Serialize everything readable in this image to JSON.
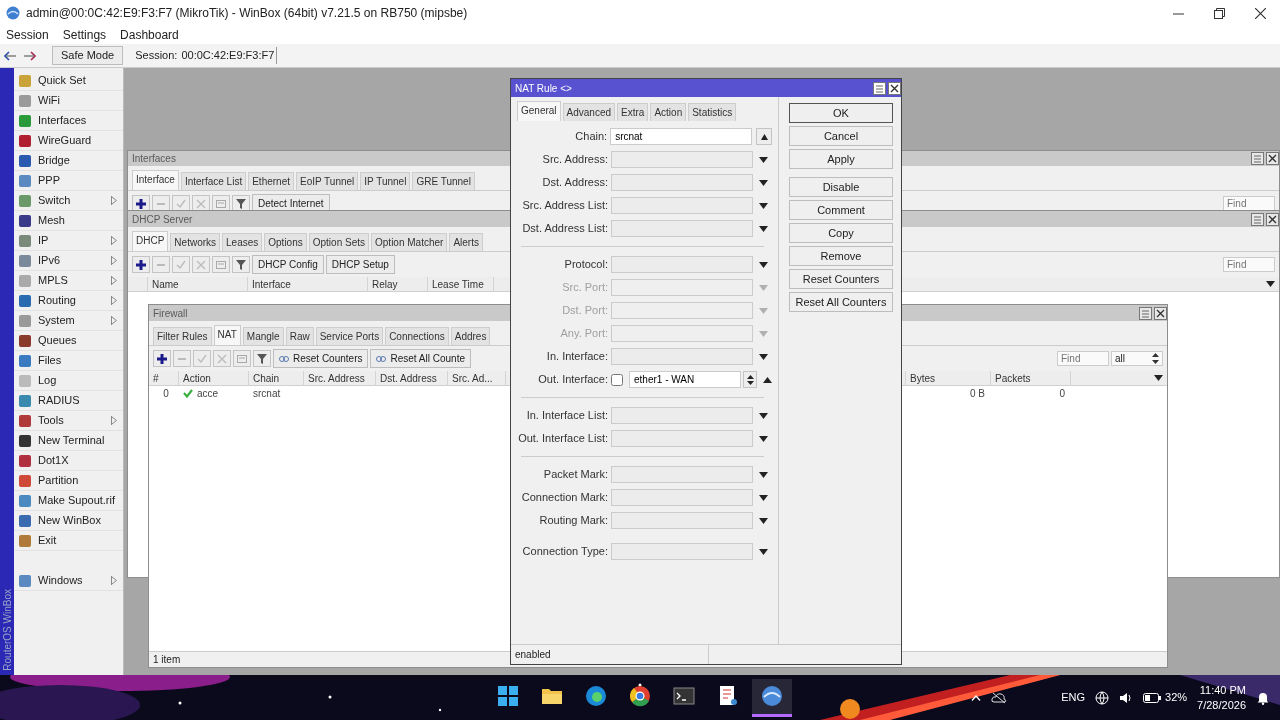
{
  "window": {
    "title": "admin@00:0C:42:E9:F3:F7 (MikroTik) - WinBox (64bit) v7.21.5 on RB750 (mipsbe)"
  },
  "menu_bar": [
    "Session",
    "Settings",
    "Dashboard"
  ],
  "toolbar": {
    "safe_mode": {
      "label": "Safe Mode",
      "on": false
    },
    "session_label": "Session:",
    "session_value": "00:0C:42:E9:F3:F7"
  },
  "side_strip": "RouterOS WinBox",
  "sidebar": {
    "items": [
      {
        "label": "Quick Set",
        "submenu": false
      },
      {
        "label": "WiFi",
        "submenu": false
      },
      {
        "label": "Interfaces",
        "submenu": false
      },
      {
        "label": "WireGuard",
        "submenu": false
      },
      {
        "label": "Bridge",
        "submenu": false
      },
      {
        "label": "PPP",
        "submenu": false
      },
      {
        "label": "Switch",
        "submenu": true
      },
      {
        "label": "Mesh",
        "submenu": false
      },
      {
        "label": "IP",
        "submenu": true
      },
      {
        "label": "IPv6",
        "submenu": true
      },
      {
        "label": "MPLS",
        "submenu": true
      },
      {
        "label": "Routing",
        "submenu": true
      },
      {
        "label": "System",
        "submenu": true
      },
      {
        "label": "Queues",
        "submenu": false
      },
      {
        "label": "Files",
        "submenu": false
      },
      {
        "label": "Log",
        "submenu": false
      },
      {
        "label": "RADIUS",
        "submenu": false
      },
      {
        "label": "Tools",
        "submenu": true
      },
      {
        "label": "New Terminal",
        "submenu": false
      },
      {
        "label": "Dot1X",
        "submenu": false
      },
      {
        "label": "Partition",
        "submenu": false
      },
      {
        "label": "Make Supout.rif",
        "submenu": false
      },
      {
        "label": "New WinBox",
        "submenu": false
      },
      {
        "label": "Exit",
        "submenu": false
      }
    ],
    "bottom_items": [
      {
        "label": "Windows",
        "submenu": true
      }
    ]
  },
  "interfaces_window": {
    "title": "Interfaces",
    "tabs": [
      {
        "label": "Interface",
        "selected": true
      },
      {
        "label": "Interface List",
        "selected": false
      },
      {
        "label": "Ethernet",
        "selected": false
      },
      {
        "label": "EoIP Tunnel",
        "selected": false
      },
      {
        "label": "IP Tunnel",
        "selected": false
      },
      {
        "label": "GRE Tunnel",
        "selected": false
      }
    ],
    "buttons": [
      "Detect Internet"
    ],
    "find": {
      "placeholder": "Find"
    }
  },
  "dhcp_window": {
    "title": "DHCP Server",
    "tabs": [
      {
        "label": "DHCP",
        "selected": true
      },
      {
        "label": "Networks",
        "selected": false
      },
      {
        "label": "Leases",
        "selected": false
      },
      {
        "label": "Options",
        "selected": false
      },
      {
        "label": "Option Sets",
        "selected": false
      },
      {
        "label": "Option Matcher",
        "selected": false
      },
      {
        "label": "Alerts",
        "selected": false
      }
    ],
    "buttons": [
      "DHCP Config",
      "DHCP Setup"
    ],
    "columns": [
      "Name",
      "Interface",
      "Relay",
      "Lease Time"
    ],
    "find": {
      "placeholder": "Find"
    }
  },
  "firewall_window": {
    "title": "Firewall",
    "tabs": [
      {
        "label": "Filter Rules",
        "selected": false
      },
      {
        "label": "NAT",
        "selected": true
      },
      {
        "label": "Mangle",
        "selected": false
      },
      {
        "label": "Raw",
        "selected": false
      },
      {
        "label": "Service Ports",
        "selected": false
      },
      {
        "label": "Connections",
        "selected": false
      },
      {
        "label": "Addres",
        "selected": false
      }
    ],
    "buttons": [
      "Reset Counters",
      "Reset All Counte"
    ],
    "find": {
      "placeholder": "Find"
    },
    "filter_value": "all",
    "columns": [
      "#",
      "Action",
      "Chain",
      "Src. Address",
      "Dst. Address",
      "Src. Ad...",
      "Bytes",
      "Packets"
    ],
    "rows": [
      {
        "enabled": true,
        "cells": [
          "0",
          "acce",
          "srcnat",
          "",
          "",
          "",
          "0 B",
          "0"
        ]
      }
    ],
    "status": "1 item"
  },
  "nat_rule_dialog": {
    "title": "NAT Rule <>",
    "tabs": [
      {
        "label": "General",
        "selected": true
      },
      {
        "label": "Advanced",
        "selected": false
      },
      {
        "label": "Extra",
        "selected": false
      },
      {
        "label": "Action",
        "selected": false
      },
      {
        "label": "Statistics",
        "selected": false
      }
    ],
    "sections": [
      {
        "divider": false,
        "fields": [
          {
            "kind": "chain",
            "label": "Chain:",
            "value": "srcnat"
          },
          {
            "kind": "combo",
            "label": "Src. Address:",
            "disabled": false
          },
          {
            "kind": "combo",
            "label": "Dst. Address:",
            "disabled": false
          },
          {
            "kind": "combo",
            "label": "Src. Address List:",
            "disabled": false
          },
          {
            "kind": "combo",
            "label": "Dst. Address List:",
            "disabled": false
          }
        ]
      },
      {
        "divider": true,
        "fields": [
          {
            "kind": "combo",
            "label": "Protocol:",
            "disabled": false
          },
          {
            "kind": "combo",
            "label": "Src. Port:",
            "disabled": true
          },
          {
            "kind": "combo",
            "label": "Dst. Port:",
            "disabled": true
          },
          {
            "kind": "combo",
            "label": "Any. Port:",
            "disabled": true
          },
          {
            "kind": "combo",
            "label": "In. Interface:",
            "disabled": false
          },
          {
            "kind": "negatable",
            "label": "Out. Interface:",
            "negated": false,
            "value": "ether1 - WAN"
          }
        ]
      },
      {
        "divider": true,
        "fields": [
          {
            "kind": "combo",
            "label": "In. Interface List:",
            "disabled": false
          },
          {
            "kind": "combo",
            "label": "Out. Interface List:",
            "disabled": false
          }
        ]
      },
      {
        "divider": true,
        "fields": [
          {
            "kind": "combo",
            "label": "Packet Mark:",
            "disabled": false
          },
          {
            "kind": "combo",
            "label": "Connection Mark:",
            "disabled": false
          },
          {
            "kind": "combo",
            "label": "Routing Mark:",
            "disabled": false
          }
        ]
      },
      {
        "divider": false,
        "fields": [
          {
            "kind": "combo",
            "label": "Connection Type:",
            "disabled": false
          }
        ]
      }
    ],
    "buttons": [
      {
        "label": "OK",
        "default": true
      },
      {
        "label": "Cancel",
        "default": false
      },
      {
        "label": "Apply",
        "default": false
      },
      {
        "label": "Disable",
        "default": false
      },
      {
        "label": "Comment",
        "default": false
      },
      {
        "label": "Copy",
        "default": false
      },
      {
        "label": "Remove",
        "default": false
      },
      {
        "label": "Reset Counters",
        "default": false
      },
      {
        "label": "Reset All Counters",
        "default": false
      }
    ],
    "status": "enabled"
  },
  "taskbar": {
    "apps": [
      {
        "kind": "start",
        "selected": false
      },
      {
        "kind": "files",
        "selected": false
      },
      {
        "kind": "edge",
        "selected": false
      },
      {
        "kind": "chrome",
        "selected": false
      },
      {
        "kind": "terminal",
        "selected": false
      },
      {
        "kind": "snip",
        "selected": false
      },
      {
        "kind": "winbox",
        "selected": true
      }
    ],
    "language": "ENG",
    "battery": "32%",
    "time": "11:40 PM",
    "date": "7/28/2026"
  }
}
